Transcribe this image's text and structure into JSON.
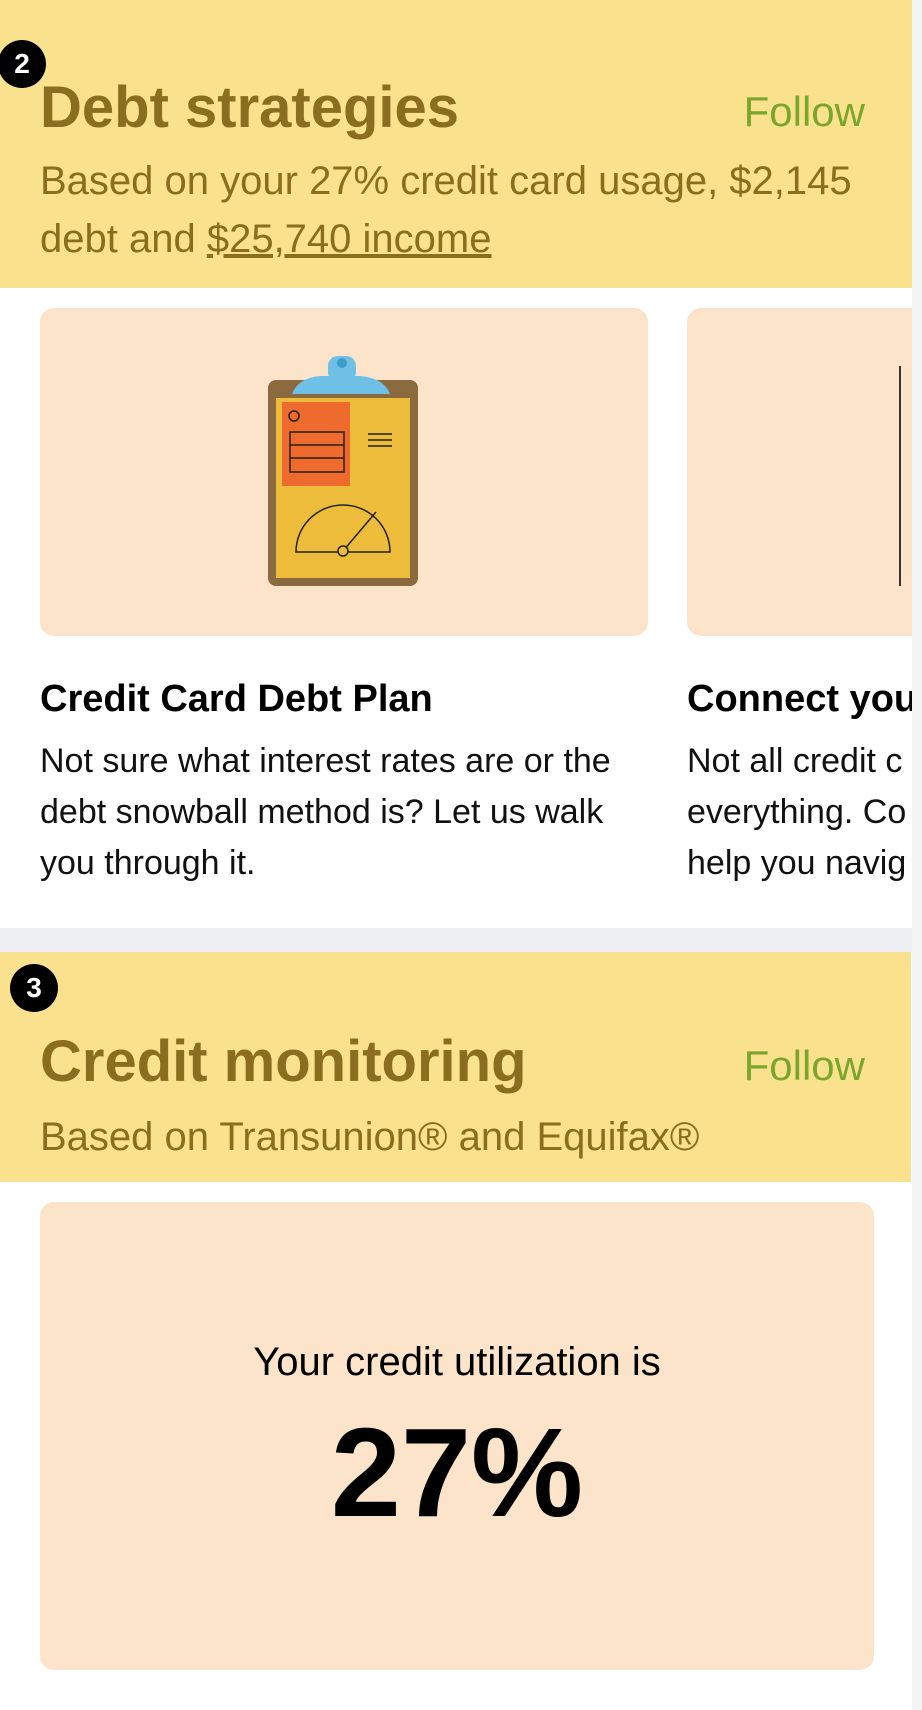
{
  "debt_section": {
    "badge": "2",
    "title": "Debt strategies",
    "follow_label": "Follow",
    "subtitle_prefix": "Based on your 27% credit card usage, $2,145 debt and ",
    "subtitle_link": "$25,740 income"
  },
  "cards": [
    {
      "title": "Credit Card Debt Plan",
      "description": "Not sure what interest rates are or the debt snowball method is? Let us walk you through it.",
      "illustration": "clipboard-icon"
    },
    {
      "title": "Connect you",
      "description": "Not all credit c everything. Co help you navig"
    }
  ],
  "credit_section": {
    "badge": "3",
    "title": "Credit monitoring",
    "follow_label": "Follow",
    "subtitle": "Based on Transunion® and Equifax®"
  },
  "utilization": {
    "label": "Your credit utilization is",
    "value": "27%"
  },
  "colors": {
    "header_bg": "#f9e18d",
    "header_text": "#8a6d1e",
    "follow": "#7ca52c",
    "card_bg": "#fbe4ca"
  }
}
